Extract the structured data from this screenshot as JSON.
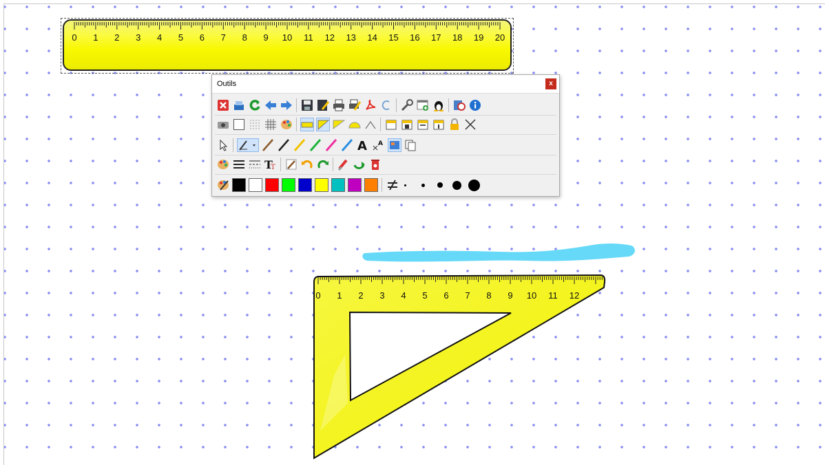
{
  "toolbox": {
    "title": "Outils",
    "close_label": "x"
  },
  "ruler": {
    "type": "straight-ruler",
    "labels": [
      "0",
      "1",
      "2",
      "3",
      "4",
      "5",
      "6",
      "7",
      "8",
      "9",
      "10",
      "11",
      "12",
      "13",
      "14",
      "15",
      "16",
      "17",
      "18",
      "19",
      "20"
    ],
    "color": "#f8f800"
  },
  "set_square": {
    "type": "set-square",
    "labels": [
      "0",
      "1",
      "2",
      "3",
      "4",
      "5",
      "6",
      "7",
      "8",
      "9",
      "10",
      "11",
      "12"
    ],
    "color": "#f8f800"
  },
  "stroke": {
    "color": "#66d9f8"
  },
  "board": {
    "dot_color": "#8a8ff0"
  },
  "palette": {
    "colors": [
      "#000000",
      "#ffffff",
      "#ff0000",
      "#00ff00",
      "#0000cc",
      "#ffff00",
      "#00c0c0",
      "#c000c0",
      "#ff8000"
    ]
  },
  "icons": {
    "row1": [
      "close-icon",
      "open-file-icon",
      "refresh-icon",
      "arrow-left-icon",
      "arrow-right-icon",
      "save-icon",
      "save-as-icon",
      "print-icon",
      "print-setup-icon",
      "pdf-icon",
      "undo-page-icon",
      "settings-icon",
      "new-window-icon",
      "linux-icon",
      "screenshot-icon",
      "info-icon"
    ],
    "row2": [
      "camera-icon",
      "blank-page-icon",
      "dot-grid-icon",
      "grid-icon",
      "background-color-icon",
      "ruler-icon",
      "set-square-icon",
      "triangle-icon",
      "protractor-icon",
      "compass-icon",
      "calendar-icon",
      "calendar-save-icon",
      "calendar-edit-icon",
      "calendar-one-icon",
      "lock-icon",
      "cross-icon"
    ],
    "row3": [
      "pointer-icon",
      "pencil-select-icon",
      "pencil-icon",
      "pencil-black-icon",
      "pencil-yellow-icon",
      "pencil-green-icon",
      "pencil-pink-icon",
      "pencil-blue-icon",
      "text-icon",
      "text-resize-icon",
      "image-icon",
      "copy-icon"
    ],
    "row4": [
      "palette-icon",
      "line-width-icon",
      "line-style-icon",
      "font-icon",
      "edit-icon",
      "undo-icon",
      "redo-icon",
      "eraser-icon",
      "rotate-icon",
      "trash-icon"
    ],
    "row5": [
      "palette-small-icon",
      "not-equal-icon"
    ]
  }
}
